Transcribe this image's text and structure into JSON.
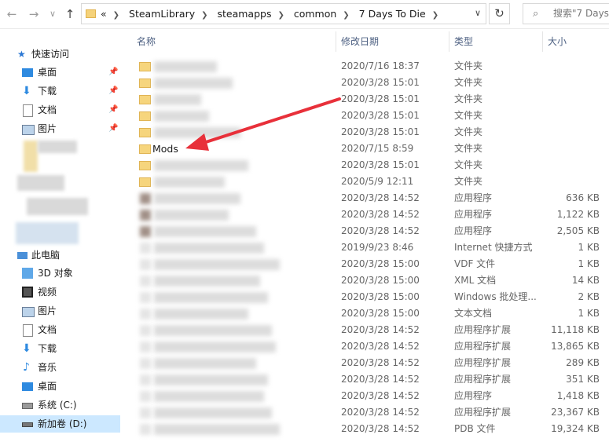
{
  "nav": {
    "path_overflow": "«",
    "breadcrumbs": [
      "SteamLibrary",
      "steamapps",
      "common",
      "7 Days To Die"
    ],
    "search_placeholder": "搜索\"7 Days"
  },
  "sidebar": {
    "quick_access": "快速访问",
    "quick_items": [
      "桌面",
      "下载",
      "文档",
      "图片"
    ],
    "this_pc": "此电脑",
    "pc_items": [
      "3D 对象",
      "视频",
      "图片",
      "文档",
      "下载",
      "音乐",
      "桌面",
      "系统 (C:)",
      "新加卷 (D:)"
    ]
  },
  "columns": {
    "name": "名称",
    "date": "修改日期",
    "type": "类型",
    "size": "大小"
  },
  "files": [
    {
      "name": "",
      "date": "2020/7/16 18:37",
      "type": "文件夹",
      "size": "",
      "folder": true
    },
    {
      "name": "",
      "date": "2020/3/28 15:01",
      "type": "文件夹",
      "size": "",
      "folder": true
    },
    {
      "name": "",
      "date": "2020/3/28 15:01",
      "type": "文件夹",
      "size": "",
      "folder": true
    },
    {
      "name": "",
      "date": "2020/3/28 15:01",
      "type": "文件夹",
      "size": "",
      "folder": true
    },
    {
      "name": "",
      "date": "2020/3/28 15:01",
      "type": "文件夹",
      "size": "",
      "folder": true
    },
    {
      "name": "Mods",
      "date": "2020/7/15 8:59",
      "type": "文件夹",
      "size": "",
      "folder": true
    },
    {
      "name": "",
      "date": "2020/3/28 15:01",
      "type": "文件夹",
      "size": "",
      "folder": true
    },
    {
      "name": "",
      "date": "2020/5/9 12:11",
      "type": "文件夹",
      "size": "",
      "folder": true
    },
    {
      "name": "",
      "date": "2020/3/28 14:52",
      "type": "应用程序",
      "size": "636 KB",
      "folder": false
    },
    {
      "name": "",
      "date": "2020/3/28 14:52",
      "type": "应用程序",
      "size": "1,122 KB",
      "folder": false
    },
    {
      "name": "",
      "date": "2020/3/28 14:52",
      "type": "应用程序",
      "size": "2,505 KB",
      "folder": false
    },
    {
      "name": "",
      "date": "2019/9/23 8:46",
      "type": "Internet 快捷方式",
      "size": "1 KB",
      "folder": false
    },
    {
      "name": "",
      "date": "2020/3/28 15:00",
      "type": "VDF 文件",
      "size": "1 KB",
      "folder": false
    },
    {
      "name": "",
      "date": "2020/3/28 15:00",
      "type": "XML 文档",
      "size": "14 KB",
      "folder": false
    },
    {
      "name": "",
      "date": "2020/3/28 15:00",
      "type": "Windows 批处理...",
      "size": "2 KB",
      "folder": false
    },
    {
      "name": "",
      "date": "2020/3/28 15:00",
      "type": "文本文档",
      "size": "1 KB",
      "folder": false
    },
    {
      "name": "",
      "date": "2020/3/28 14:52",
      "type": "应用程序扩展",
      "size": "11,118 KB",
      "folder": false
    },
    {
      "name": "",
      "date": "2020/3/28 14:52",
      "type": "应用程序扩展",
      "size": "13,865 KB",
      "folder": false
    },
    {
      "name": "",
      "date": "2020/3/28 14:52",
      "type": "应用程序扩展",
      "size": "289 KB",
      "folder": false
    },
    {
      "name": "",
      "date": "2020/3/28 14:52",
      "type": "应用程序扩展",
      "size": "351 KB",
      "folder": false
    },
    {
      "name": "",
      "date": "2020/3/28 14:52",
      "type": "应用程序",
      "size": "1,418 KB",
      "folder": false
    },
    {
      "name": "",
      "date": "2020/3/28 14:52",
      "type": "应用程序扩展",
      "size": "23,367 KB",
      "folder": false
    },
    {
      "name": "",
      "date": "2020/3/28 14:52",
      "type": "PDB 文件",
      "size": "19,324 KB",
      "folder": false
    }
  ],
  "colors": {
    "accent": "#cce8ff",
    "arrow": "#e8303a",
    "folder": "#f6d57d"
  }
}
